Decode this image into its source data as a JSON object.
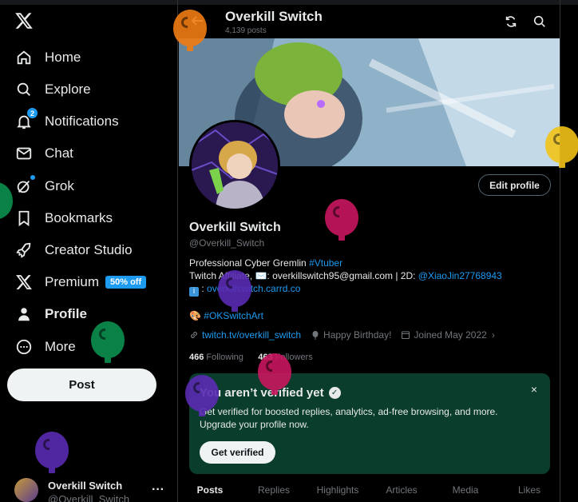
{
  "sidebar": {
    "items": [
      {
        "label": "Home"
      },
      {
        "label": "Explore"
      },
      {
        "label": "Notifications",
        "badge": "2"
      },
      {
        "label": "Chat"
      },
      {
        "label": "Grok"
      },
      {
        "label": "Bookmarks"
      },
      {
        "label": "Creator Studio"
      },
      {
        "label": "Premium",
        "badge": "50% off"
      },
      {
        "label": "Profile"
      },
      {
        "label": "More"
      }
    ],
    "post_label": "Post",
    "account": {
      "name": "Overkill Switch",
      "handle": "@Overkill_Switch"
    }
  },
  "header": {
    "title": "Overkill Switch",
    "subtitle": "4,139 posts"
  },
  "profile": {
    "name": "Overkill Switch",
    "handle": "@Overkill_Switch",
    "edit_label": "Edit profile",
    "bio": {
      "line1_text": "Professional Cyber Gremlin ",
      "line1_tag": "#Vtuber",
      "line2_text": "Twitch Affiliate, ✉️: overkillswitch95@gmail.com | 2D: ",
      "line2_link": "@XiaoJin27768943",
      "line3_prefix": ": ",
      "line3_link": "overkillswitch.carrd.co",
      "line4_tag": "#OKSwitchArt"
    },
    "meta": {
      "link": "twitch.tv/overkill_switch",
      "birthday": "Happy Birthday!",
      "joined": "Joined May 2022"
    },
    "following_count": "466",
    "following_label": "Following",
    "followers_count": "463",
    "followers_label": "Followers"
  },
  "verify": {
    "title": "You aren’t verified yet",
    "body": "Get verified for boosted replies, analytics, ad-free browsing, and more. Upgrade your profile now.",
    "button": "Get verified",
    "close": "×"
  },
  "tabs": [
    {
      "label": "Posts"
    },
    {
      "label": "Replies"
    },
    {
      "label": "Highlights"
    },
    {
      "label": "Articles"
    },
    {
      "label": "Media"
    },
    {
      "label": "Likes"
    }
  ],
  "colors": {
    "accent": "#1d9bf0",
    "verify_bg": "#0a3d2b",
    "balloons": [
      "#f07c12",
      "#f2c318",
      "#0a8f4f",
      "#c8175f",
      "#5a2bb3"
    ]
  }
}
